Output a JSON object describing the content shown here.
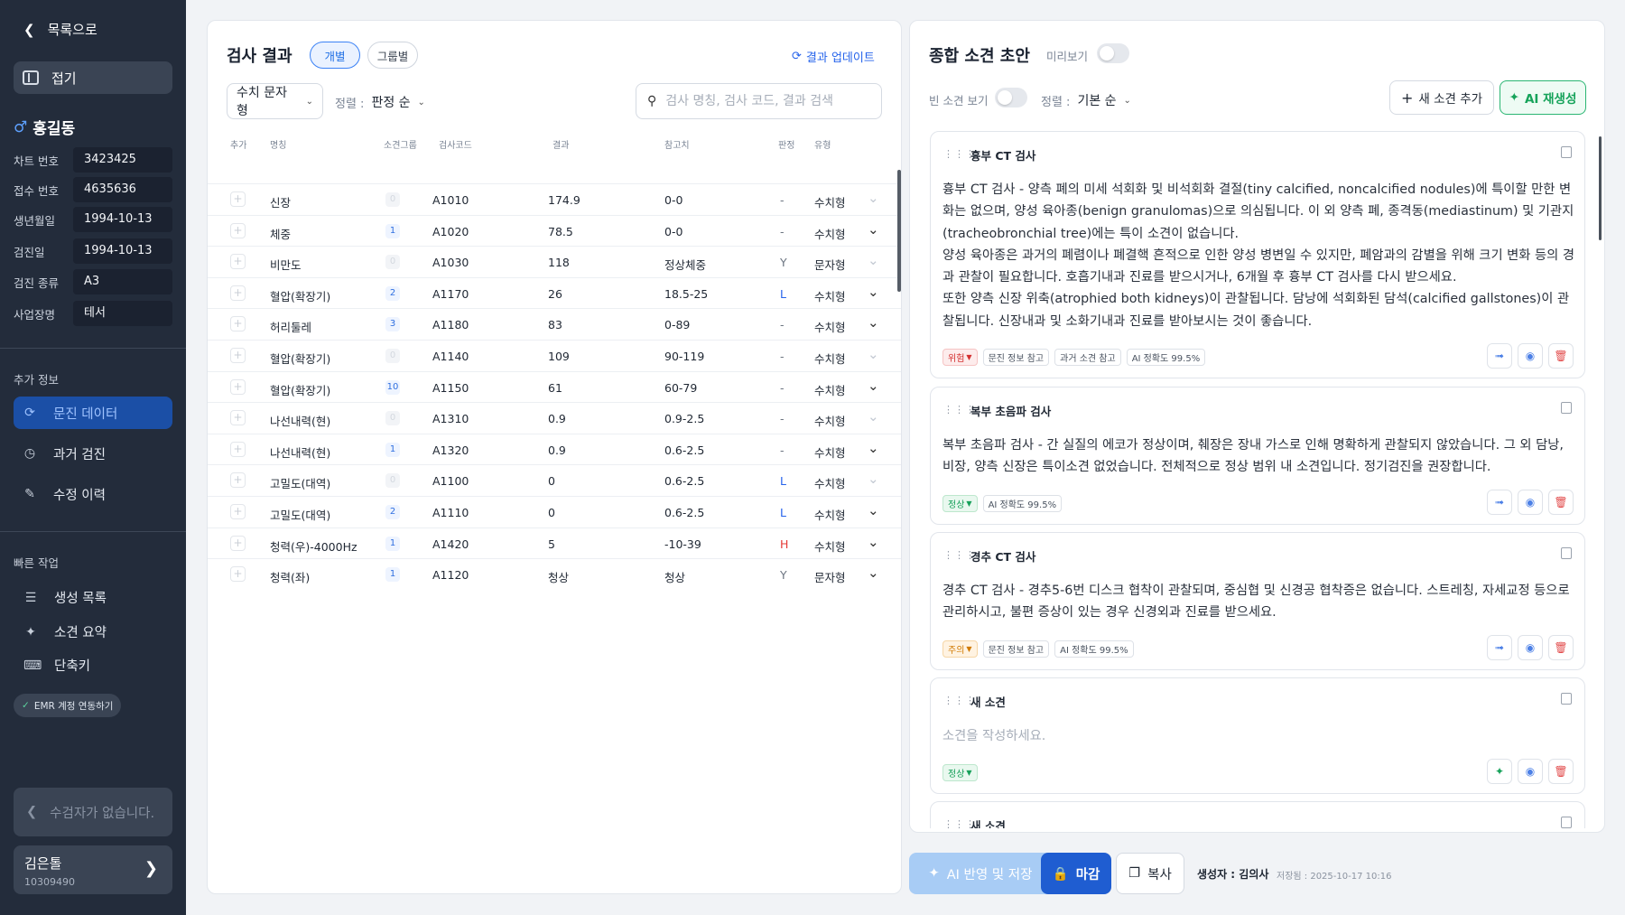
{
  "sidebar": {
    "back_label": "목록으로",
    "fold_label": "접기",
    "patient_name": "홍길동",
    "patient_gender_icon": "male-icon",
    "info": [
      {
        "key": "차트 번호",
        "value": "3423425"
      },
      {
        "key": "접수 번호",
        "value": "4635636"
      },
      {
        "key": "생년월일",
        "value": "1994-10-13"
      },
      {
        "key": "검진일",
        "value": "1994-10-13"
      },
      {
        "key": "검진 종류",
        "value": "A3"
      },
      {
        "key": "사업장명",
        "value": "테서"
      }
    ],
    "extra_title": "추가 정보",
    "menu": [
      {
        "label": "문진 데이터",
        "icon": "refresh-icon",
        "active": true
      },
      {
        "label": "과거 검진",
        "icon": "history-icon",
        "active": false
      },
      {
        "label": "수정 이력",
        "icon": "edit-icon",
        "active": false
      }
    ],
    "quick_title": "빠른 작업",
    "quick": [
      {
        "label": "생성 목록",
        "icon": "list-icon"
      },
      {
        "label": "소견 요약",
        "icon": "wand-icon"
      },
      {
        "label": "단축키",
        "icon": "keyboard-icon"
      }
    ],
    "emr_label": "EMR 계정 연동하기",
    "prev_label": "수검자가 없습니다.",
    "next_name": "김은톨",
    "next_id": "10309490"
  },
  "results": {
    "title": "검사 결과",
    "tab_individual": "개별",
    "tab_group": "그룹별",
    "update_label": "결과 업데이트",
    "type_select": "수치 문자형",
    "sort_label": "정렬 :",
    "sort_value": "판정 순",
    "search_placeholder": "검사 명칭, 검사 코드, 결과 검색",
    "headers": {
      "add": "추가",
      "name": "명칭",
      "group": "소견그룹",
      "code": "검사코드",
      "result": "결과",
      "ref": "참고치",
      "judge": "판정",
      "type": "유형"
    },
    "rows": [
      {
        "name": "신장",
        "group": "0",
        "code": "A1010",
        "result": "174.9",
        "ref": "0-0",
        "judge": "-",
        "type": "수치형",
        "expanded": false
      },
      {
        "name": "체중",
        "group": "1",
        "code": "A1020",
        "result": "78.5",
        "ref": "0-0",
        "judge": "-",
        "type": "수치형",
        "expanded": true
      },
      {
        "name": "비만도",
        "group": "0",
        "code": "A1030",
        "result": "118",
        "ref": "정상체중",
        "judge": "Y",
        "type": "문자형",
        "expanded": false
      },
      {
        "name": "혈압(확장기)",
        "group": "2",
        "code": "A1170",
        "result": "26",
        "ref": "18.5-25",
        "judge": "L",
        "type": "수치형",
        "expanded": true
      },
      {
        "name": "허리둘레",
        "group": "3",
        "code": "A1180",
        "result": "83",
        "ref": "0-89",
        "judge": "-",
        "type": "수치형",
        "expanded": true
      },
      {
        "name": "혈압(확장기)",
        "group": "0",
        "code": "A1140",
        "result": "109",
        "ref": "90-119",
        "judge": "-",
        "type": "수치형",
        "expanded": false
      },
      {
        "name": "혈압(확장기)",
        "group": "10",
        "code": "A1150",
        "result": "61",
        "ref": "60-79",
        "judge": "-",
        "type": "수치형",
        "expanded": true
      },
      {
        "name": "나선내력(현)",
        "group": "0",
        "code": "A1310",
        "result": "0.9",
        "ref": "0.9-2.5",
        "judge": "-",
        "type": "수치형",
        "expanded": false
      },
      {
        "name": "나선내력(현)",
        "group": "1",
        "code": "A1320",
        "result": "0.9",
        "ref": "0.6-2.5",
        "judge": "-",
        "type": "수치형",
        "expanded": true
      },
      {
        "name": "고밀도(대역)",
        "group": "0",
        "code": "A1100",
        "result": "0",
        "ref": "0.6-2.5",
        "judge": "L",
        "type": "수치형",
        "expanded": false
      },
      {
        "name": "고밀도(대역)",
        "group": "2",
        "code": "A1110",
        "result": "0",
        "ref": "0.6-2.5",
        "judge": "L",
        "type": "수치형",
        "expanded": true
      },
      {
        "name": "청력(우)-4000Hz",
        "group": "1",
        "code": "A1420",
        "result": "5",
        "ref": "-10-39",
        "judge": "H",
        "type": "수치형",
        "expanded": true
      },
      {
        "name": "청력(좌)",
        "group": "1",
        "code": "A1120",
        "result": "청상",
        "ref": "청상",
        "judge": "Y",
        "type": "문자형",
        "expanded": true
      }
    ]
  },
  "findings": {
    "title": "종합 소견 초안",
    "preview_label": "미리보기",
    "empty_label": "빈 소견 보기",
    "sort_label": "정렬 :",
    "sort_value": "기본 순",
    "add_label": "새 소견 추가",
    "regen_label": "AI 재생성",
    "cards": [
      {
        "title": "흉부 CT 검사",
        "body": "흉부 CT 검사 - 양측 폐의 미세 석회화 및 비석회화 결절(tiny calcified, noncalcified nodules)에 특이할 만한 변화는 없으며, 양성 육아종(benign granulomas)으로 의심됩니다. 이 외 양측 폐, 종격동(mediastinum) 및 기관지(tracheobronchial tree)에는 특이 소견이 없습니다.\n양성 육아종은 과거의 폐렴이나 폐결핵 흔적으로 인한 양성 병변일 수 있지만, 폐암과의 감별을 위해 크기 변화 등의 경과 관찰이 필요합니다. 호흡기내과 진료를 받으시거나, 6개월 후 흉부 CT 검사를 다시 받으세요.\n또한 양측 신장 위축(atrophied both kidneys)이 관찰됩니다. 담낭에 석회화된 담석(calcified gallstones)이 관찰됩니다. 신장내과 및 소화기내과 진료를 받아보시는 것이 좋습니다.",
        "status": "위험",
        "status_kind": "danger",
        "tags": [
          "문진 정보 참고",
          "과거 소견 참고",
          "AI 정확도 99.5%"
        ]
      },
      {
        "title": "복부 초음파 검사",
        "body": "복부 초음파 검사 - 간 실질의 에코가 정상이며, 췌장은 장내 가스로 인해 명확하게 관찰되지 않았습니다. 그 외 담낭, 비장, 양측 신장은 특이소견 없었습니다. 전체적으로 정상 범위 내 소견입니다. 정기검진을 권장합니다.",
        "status": "정상",
        "status_kind": "normal",
        "tags": [
          "AI 정확도 99.5%"
        ]
      },
      {
        "title": "경추 CT 검사",
        "body": "경추 CT 검사 - 경추5-6번 디스크 협착이 관찰되며, 중심협 및 신경공 협착증은 없습니다. 스트레칭, 자세교정 등으로 관리하시고, 불편 증상이 있는 경우 신경외과 진료를 받으세요.",
        "status": "주의",
        "status_kind": "warn",
        "tags": [
          "문진 정보 참고",
          "AI 정확도 99.5%"
        ]
      },
      {
        "title": "새 소견",
        "placeholder": "소견을 작성하세요.",
        "status": "정상",
        "status_kind": "normal",
        "tags": []
      },
      {
        "title": "새 소견"
      }
    ]
  },
  "footer": {
    "ai_save_label": "AI 반영 및 저장",
    "close_label": "마감",
    "copy_label": "복사",
    "creator": "생성자 : 김의사",
    "saved_at": "저장됨 : 2025-10-17 10:16"
  }
}
